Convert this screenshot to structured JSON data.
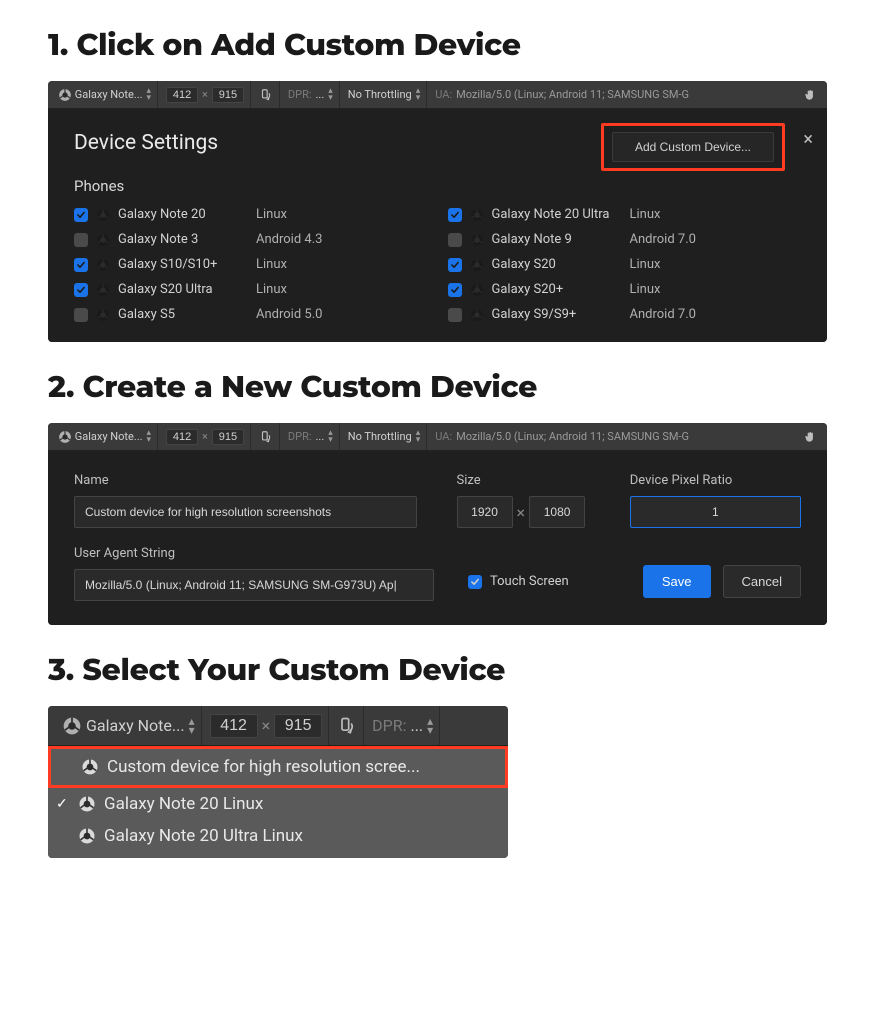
{
  "steps": {
    "s1": "1. Click on Add Custom Device",
    "s2": "2. Create a New Custom Device",
    "s3": "3. Select Your Custom Device"
  },
  "toolbar": {
    "device": "Galaxy Note...",
    "width": "412",
    "height": "915",
    "mul": "×",
    "dpr_label": "DPR:",
    "dpr_val": "...",
    "throttle": "No Throttling",
    "ua_label": "UA:",
    "ua_text": "Mozilla/5.0 (Linux; Android 11; SAMSUNG SM-G"
  },
  "panel1": {
    "title": "Device Settings",
    "add_btn": "Add Custom Device...",
    "subhead": "Phones",
    "close": "×",
    "devices_left": [
      {
        "checked": true,
        "name": "Galaxy Note 20",
        "os": "Linux"
      },
      {
        "checked": false,
        "name": "Galaxy Note 3",
        "os": "Android 4.3"
      },
      {
        "checked": true,
        "name": "Galaxy S10/S10+",
        "os": "Linux"
      },
      {
        "checked": true,
        "name": "Galaxy S20 Ultra",
        "os": "Linux"
      },
      {
        "checked": false,
        "name": "Galaxy S5",
        "os": "Android 5.0"
      }
    ],
    "devices_right": [
      {
        "checked": true,
        "name": "Galaxy Note 20 Ultra",
        "os": "Linux"
      },
      {
        "checked": false,
        "name": "Galaxy Note 9",
        "os": "Android 7.0"
      },
      {
        "checked": true,
        "name": "Galaxy S20",
        "os": "Linux"
      },
      {
        "checked": true,
        "name": "Galaxy S20+",
        "os": "Linux"
      },
      {
        "checked": false,
        "name": "Galaxy S9/S9+",
        "os": "Android 7.0"
      }
    ]
  },
  "panel2": {
    "name_label": "Name",
    "name_val": "Custom device for high resolution screenshots",
    "size_label": "Size",
    "size_w": "1920",
    "size_h": "1080",
    "dpr_label": "Device Pixel Ratio",
    "dpr_val": "1",
    "ua_label": "User Agent String",
    "ua_val": "Mozilla/5.0 (Linux; Android 11; SAMSUNG SM-G973U) Ap|",
    "touch_label": "Touch Screen",
    "save": "Save",
    "cancel": "Cancel"
  },
  "panel3": {
    "items": [
      {
        "label": "Custom device for high resolution scree...",
        "selected": false,
        "hl": true
      },
      {
        "label": "Galaxy Note 20 Linux",
        "selected": true,
        "hl": false
      },
      {
        "label": "Galaxy Note 20 Ultra Linux",
        "selected": false,
        "hl": false
      }
    ]
  }
}
